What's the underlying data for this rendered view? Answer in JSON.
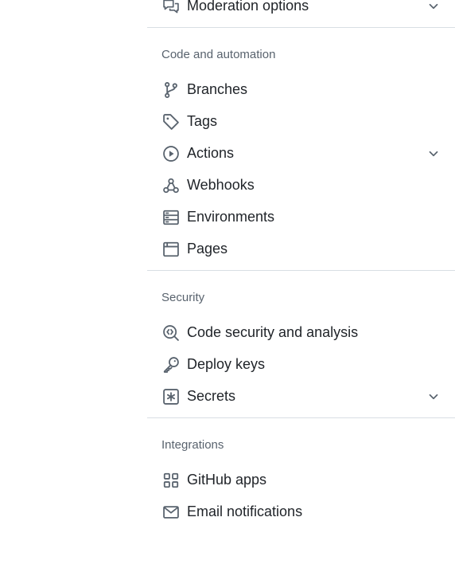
{
  "sections": {
    "top": {
      "items": [
        {
          "label": "Moderation options",
          "icon": "comment-discussion-icon",
          "expandable": true
        }
      ]
    },
    "code_and_automation": {
      "title": "Code and automation",
      "items": [
        {
          "label": "Branches",
          "icon": "git-branch-icon"
        },
        {
          "label": "Tags",
          "icon": "tag-icon"
        },
        {
          "label": "Actions",
          "icon": "play-icon",
          "expandable": true
        },
        {
          "label": "Webhooks",
          "icon": "webhook-icon"
        },
        {
          "label": "Environments",
          "icon": "server-icon"
        },
        {
          "label": "Pages",
          "icon": "browser-icon"
        }
      ]
    },
    "security": {
      "title": "Security",
      "items": [
        {
          "label": "Code security and analysis",
          "icon": "codescan-icon"
        },
        {
          "label": "Deploy keys",
          "icon": "key-icon"
        },
        {
          "label": "Secrets",
          "icon": "key-asterisk-icon",
          "expandable": true
        }
      ]
    },
    "integrations": {
      "title": "Integrations",
      "items": [
        {
          "label": "GitHub apps",
          "icon": "apps-icon"
        },
        {
          "label": "Email notifications",
          "icon": "mail-icon"
        }
      ]
    }
  },
  "colors": {
    "text": "#1f2328",
    "muted": "#59636e",
    "divider": "#d8dee4",
    "icon": "#59636e"
  }
}
